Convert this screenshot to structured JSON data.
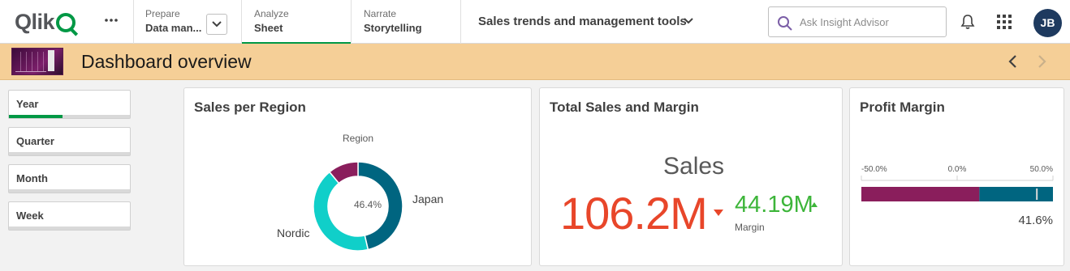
{
  "app": {
    "logo": "Qlik",
    "more_icon": "ellipsis-icon",
    "nav": [
      {
        "small": "Prepare",
        "big": "Data man..."
      },
      {
        "small": "Analyze",
        "big": "Sheet"
      },
      {
        "small": "Narrate",
        "big": "Storytelling"
      }
    ],
    "app_title": "Sales trends and management tools",
    "search_placeholder": "Ask Insight Advisor",
    "user_initials": "JB",
    "accent": "#009845"
  },
  "sheet": {
    "title": "Dashboard overview",
    "header_color": "#f5cf97"
  },
  "filters": [
    "Year",
    "Quarter",
    "Month",
    "Week"
  ],
  "cards": {
    "region": {
      "title": "Sales per Region",
      "legend_title": "Region",
      "center_label": "46.4%",
      "slice_labels": [
        "Japan",
        "Nordic"
      ]
    },
    "kpi": {
      "title": "Total Sales and Margin",
      "main_label": "Sales",
      "main_value": "106.2M",
      "main_color": "#e8462a",
      "second_value": "44.19M",
      "second_label": "Margin",
      "second_color": "#3db53a"
    },
    "profit": {
      "title": "Profit Margin",
      "value_label": "41.6%"
    }
  },
  "chart_data": [
    {
      "type": "pie",
      "title": "Sales per Region",
      "legend_title": "Region",
      "center_label": "46.4%",
      "slices": [
        {
          "label": "Japan",
          "value": 46.4,
          "color": "#006580"
        },
        {
          "label": "Nordic",
          "value": 42.6,
          "color": "#10cfc9"
        },
        {
          "label": "",
          "value": 11.0,
          "color": "#8a1e5c"
        }
      ]
    },
    {
      "type": "bar",
      "title": "Profit Margin",
      "ticks": [
        "-50.0%",
        "0.0%",
        "50.0%"
      ],
      "xlim": [
        -50,
        50
      ],
      "value": 41.6,
      "value_label": "41.6%",
      "segments": [
        {
          "from": -50,
          "to": 11.6,
          "color": "#8a1e5c"
        },
        {
          "from": 11.6,
          "to": 50,
          "color": "#006580"
        }
      ],
      "marker": 41.6
    }
  ]
}
